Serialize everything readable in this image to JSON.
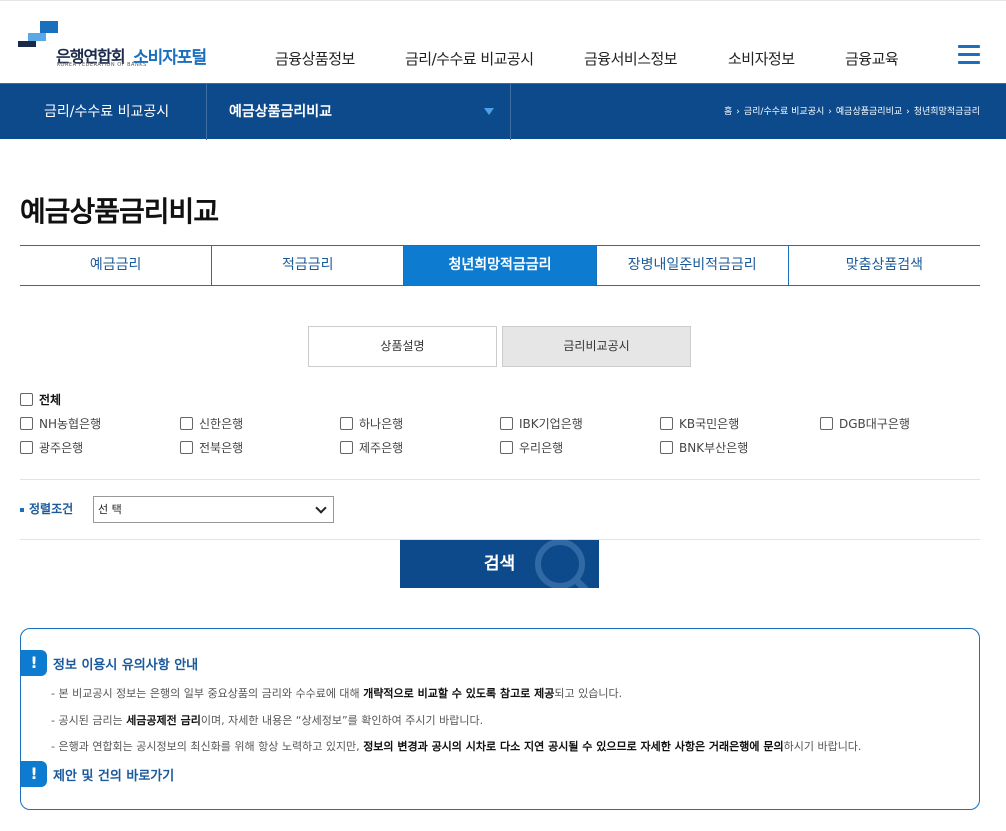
{
  "brand": {
    "name_ko": "은행연합회",
    "name_en": "KOREA FEDERATION OF BANKS",
    "portal": "소비자포털"
  },
  "gnb": [
    "금융상품정보",
    "금리/수수료 비교공시",
    "금융서비스정보",
    "소비자정보",
    "금융교육"
  ],
  "subnav": {
    "section": "금리/수수료 비교공시",
    "current": "예금상품금리비교",
    "breadcrumb": [
      "홈",
      "금리/수수료 비교공시",
      "예금상품금리비교",
      "청년희망적금금리"
    ]
  },
  "page_title": "예금상품금리비교",
  "tabs": [
    {
      "label": "예금금리",
      "active": false
    },
    {
      "label": "적금금리",
      "active": false
    },
    {
      "label": "청년희망적금금리",
      "active": true
    },
    {
      "label": "장병내일준비적금금리",
      "active": false
    },
    {
      "label": "맞춤상품검색",
      "active": false
    }
  ],
  "segment": {
    "left": "상품설명",
    "right": "금리비교공시",
    "active": "right"
  },
  "banks": {
    "all_label": "전체",
    "items": [
      "NH농협은행",
      "신한은행",
      "하나은행",
      "IBK기업은행",
      "KB국민은행",
      "DGB대구은행",
      "광주은행",
      "전북은행",
      "제주은행",
      "우리은행",
      "BNK부산은행"
    ]
  },
  "sort": {
    "label": "정렬조건",
    "selected": "선 택"
  },
  "search_label": "검색",
  "notice": {
    "title": "정보 이용시 유의사항 안내",
    "lines": [
      [
        "- 본 비교공시 정보는 은행의 일부 중요상품의 금리와 수수료에 대해 ",
        "개략적으로 비교할 수 있도록 참고로 제공",
        "되고 있습니다."
      ],
      [
        "- 공시된 금리는 ",
        "세금공제전 금리",
        "이며, 자세한 내용은 “상세정보”를 확인하여 주시기 바랍니다."
      ],
      [
        "- 은행과 연합회는 공시정보의 최신화를 위해 항상 노력하고 있지만, ",
        "정보의 변경과 공시의 시차로 다소 지연 공시될 수 있으므로 자세한 사항은 거래은행에 문의",
        "하시기 바랍니다."
      ]
    ],
    "link_title": "제안 및 건의 바로가기"
  },
  "colors": {
    "primary_dark": "#0d4a8c",
    "primary": "#0d7bd0",
    "accent": "#1a6fbf"
  }
}
